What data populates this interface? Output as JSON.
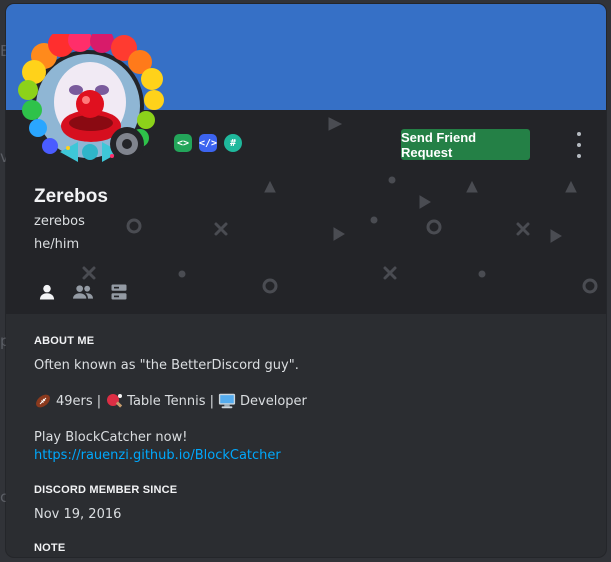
{
  "profile": {
    "display_name": "Zerebos",
    "username": "zerebos",
    "pronouns": "he/him",
    "status": "offline",
    "badges": [
      "active-developer-badge",
      "developer-badge",
      "hypesquad-badge"
    ],
    "badge_colors": [
      "#23a55a",
      "#3c64f0",
      "#1fb89c"
    ],
    "banner_color": "#3670c6"
  },
  "actions": {
    "send_friend_request_label": "Send Friend Request",
    "more_icon": "kebab-menu-icon"
  },
  "tabs": [
    {
      "name": "user-info",
      "icon": "person-icon",
      "selected": true
    },
    {
      "name": "mutual-friends",
      "icon": "people-icon",
      "selected": false
    },
    {
      "name": "mutual-servers",
      "icon": "servers-icon",
      "selected": false
    }
  ],
  "about": {
    "title": "ABOUT ME",
    "line1": "Often known as \"the BetterDiscord guy\".",
    "hobby1": "49ers |",
    "hobby2": "Table Tennis |",
    "hobby3": "Developer",
    "line3": "Play BlockCatcher now!",
    "link": "https://rauenzi.github.io/BlockCatcher"
  },
  "member_since": {
    "title": "DISCORD MEMBER SINCE",
    "date": "Nov 19, 2016"
  },
  "note": {
    "title": "NOTE"
  },
  "background": {
    "edge_letters": [
      "E",
      "v",
      "p",
      "c"
    ]
  },
  "colors": {
    "accent_green": "#248046",
    "link": "#00a8fc",
    "header_bg": "#232428",
    "body_bg": "#2b2d31"
  }
}
